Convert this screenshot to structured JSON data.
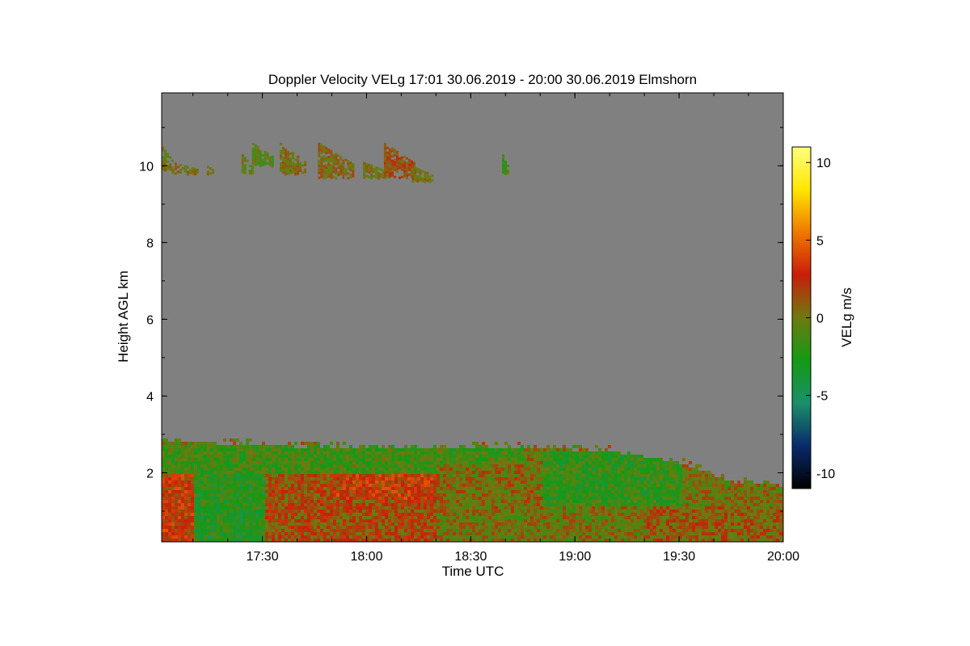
{
  "chart_data": {
    "type": "heatmap",
    "title": "Doppler Velocity VELg   17:01 30.06.2019 - 20:00 30.06.2019 Elmshorn",
    "xlabel": "Time UTC",
    "ylabel": "Height AGL km",
    "x_ticks": [
      "17:30",
      "18:00",
      "18:30",
      "19:00",
      "19:30",
      "20:00"
    ],
    "y_ticks": [
      "2",
      "4",
      "6",
      "8",
      "10"
    ],
    "xlim": [
      "17:01",
      "20:00"
    ],
    "ylim": [
      0.2,
      11.9
    ],
    "colorbar": {
      "label": "VELg m/s",
      "ticks": [
        "10",
        "5",
        "0",
        "-5",
        "-10"
      ],
      "range": [
        -11,
        11
      ],
      "colors": [
        "#000000",
        "#0a2a6b",
        "#1a8f6a",
        "#149a14",
        "#6e7a10",
        "#c81e0a",
        "#f07800",
        "#ffe600",
        "#ffff80"
      ]
    },
    "background_color": "#808080",
    "boundary_layer": {
      "top_km": [
        {
          "t": "17:01",
          "h": 2.85
        },
        {
          "t": "17:20",
          "h": 2.8
        },
        {
          "t": "17:45",
          "h": 2.7
        },
        {
          "t": "18:10",
          "h": 2.65
        },
        {
          "t": "18:40",
          "h": 2.7
        },
        {
          "t": "19:10",
          "h": 2.6
        },
        {
          "t": "19:30",
          "h": 2.3
        },
        {
          "t": "19:45",
          "h": 1.8
        },
        {
          "t": "20:00",
          "h": 1.7
        }
      ],
      "regions": [
        {
          "t0": "17:01",
          "t1": "17:10",
          "h0": 0.2,
          "h1": 2.0,
          "velocity": 2.5
        },
        {
          "t0": "17:10",
          "t1": "17:30",
          "h0": 0.2,
          "h1": 2.2,
          "velocity": -2.5
        },
        {
          "t0": "17:30",
          "t1": "18:20",
          "h0": 0.2,
          "h1": 2.0,
          "velocity": 1.5
        },
        {
          "t0": "17:50",
          "t1": "18:20",
          "h0": 1.3,
          "h1": 2.1,
          "velocity": 2.5
        },
        {
          "t0": "17:01",
          "t1": "18:45",
          "h0": 2.0,
          "h1": 2.8,
          "velocity": -1.5
        },
        {
          "t0": "18:20",
          "t1": "18:55",
          "h0": 1.0,
          "h1": 2.3,
          "velocity": 0.3
        },
        {
          "t0": "18:50",
          "t1": "19:30",
          "h0": 1.2,
          "h1": 2.6,
          "velocity": -2.0
        },
        {
          "t0": "19:20",
          "t1": "20:00",
          "h0": 0.2,
          "h1": 1.2,
          "velocity": 1.0
        }
      ]
    },
    "cirrus_clouds": [
      {
        "t0": "17:01",
        "t1": "17:04",
        "h0": 9.9,
        "h1": 10.5,
        "velocity": 0.2
      },
      {
        "t0": "17:04",
        "t1": "17:11",
        "h0": 9.8,
        "h1": 10.1,
        "velocity": 0.3
      },
      {
        "t0": "17:14",
        "t1": "17:16",
        "h0": 9.8,
        "h1": 10.0,
        "velocity": 0.3
      },
      {
        "t0": "17:24",
        "t1": "17:27",
        "h0": 9.8,
        "h1": 10.3,
        "velocity": -0.5
      },
      {
        "t0": "17:27",
        "t1": "17:33",
        "h0": 10.0,
        "h1": 10.6,
        "velocity": -0.8
      },
      {
        "t0": "17:35",
        "t1": "17:42",
        "h0": 9.8,
        "h1": 10.6,
        "velocity": 0.3
      },
      {
        "t0": "17:46",
        "t1": "17:56",
        "h0": 9.7,
        "h1": 10.6,
        "velocity": 0.5
      },
      {
        "t0": "17:59",
        "t1": "18:06",
        "h0": 9.7,
        "h1": 10.1,
        "velocity": 0.3
      },
      {
        "t0": "18:05",
        "t1": "18:14",
        "h0": 9.7,
        "h1": 10.6,
        "velocity": 1.5
      },
      {
        "t0": "18:13",
        "t1": "18:19",
        "h0": 9.6,
        "h1": 10.0,
        "velocity": 0.4
      },
      {
        "t0": "18:39",
        "t1": "18:41",
        "h0": 9.8,
        "h1": 10.3,
        "velocity": -1.5
      }
    ]
  }
}
